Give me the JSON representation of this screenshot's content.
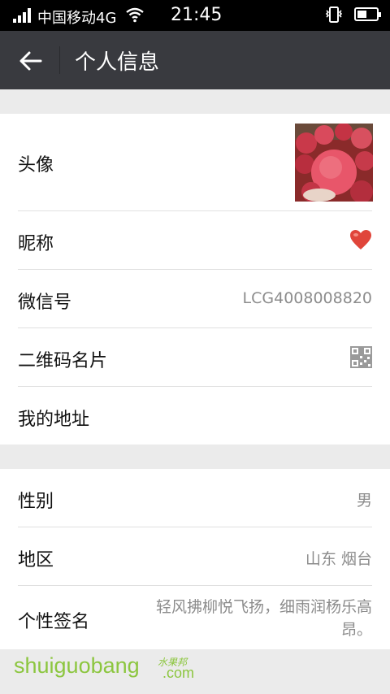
{
  "status_bar": {
    "carrier": "中国移动4G",
    "time": "21:45",
    "battery_level": 0.5
  },
  "header": {
    "title": "个人信息"
  },
  "profile": {
    "avatar_label": "头像",
    "nickname_label": "昵称",
    "wechat_id_label": "微信号",
    "wechat_id_value": "LCG4008008820",
    "qr_code_label": "二维码名片",
    "address_label": "我的地址"
  },
  "details": {
    "gender_label": "性别",
    "gender_value": "男",
    "region_label": "地区",
    "region_value": "山东 烟台",
    "signature_label": "个性签名",
    "signature_value": "轻风拂柳悦飞扬，细雨润杨乐高昂。"
  },
  "watermark": {
    "text": "shuiguobang",
    "sub": "水果邦",
    "com": ".com"
  },
  "colors": {
    "header_bg": "#393a3f",
    "page_bg": "#ebebeb",
    "accent_watermark": "#8cc63f"
  },
  "icons": [
    "back-arrow-icon",
    "heart-icon",
    "qr-code-icon",
    "signal-icon",
    "wifi-icon",
    "vibrate-icon",
    "battery-icon"
  ]
}
